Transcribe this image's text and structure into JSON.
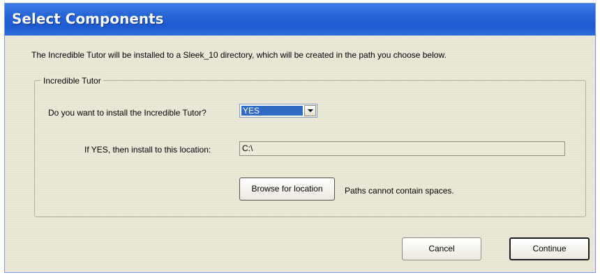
{
  "title": "Select Components",
  "intro": "The Incredible Tutor will be installed to a Sleek_10 directory, which will be created in the path you choose below.",
  "group": {
    "legend": "Incredible Tutor",
    "question_label": "Do you want to install the Incredible Tutor?",
    "install_select": {
      "value": "YES"
    },
    "location_label": "If YES, then install to this location:",
    "location_value": "C:\\",
    "browse_label": "Browse for location",
    "paths_hint": "Paths cannot contain spaces."
  },
  "buttons": {
    "cancel": "Cancel",
    "continue": "Continue"
  },
  "colors": {
    "title_bar": "#2866d8",
    "selection": "#316ac5",
    "dialog_bg": "#ece9d8"
  }
}
